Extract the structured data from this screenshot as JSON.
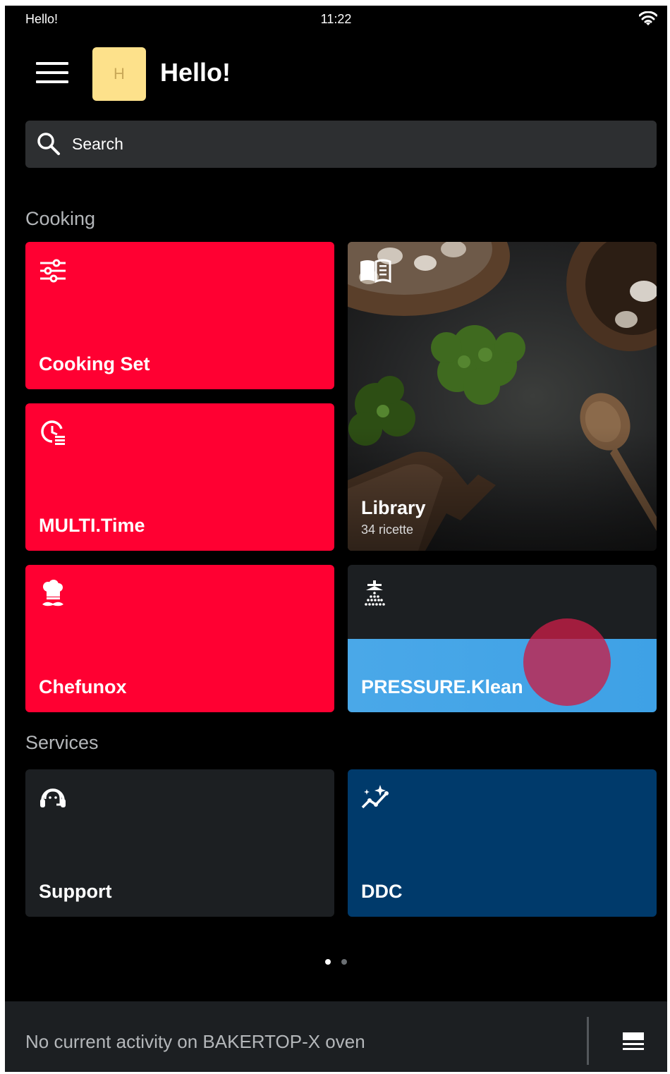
{
  "status_bar": {
    "left_text": "Hello!",
    "time": "11:22"
  },
  "header": {
    "avatar_initial": "H",
    "title": "Hello!"
  },
  "search": {
    "placeholder": "Search"
  },
  "sections": {
    "cooking": "Cooking",
    "services": "Services"
  },
  "tiles": {
    "cooking_set": "Cooking Set",
    "multi_time": "MULTI.Time",
    "chefunox": "Chefunox",
    "library": "Library",
    "library_count": "34 ricette",
    "pressure_klean": "PRESSURE.Klean",
    "support": "Support",
    "ddc": "DDC"
  },
  "bottom_bar": {
    "message": "No current activity on BAKERTOP-X oven"
  },
  "colors": {
    "accent_red": "#ff0032",
    "tile_dark": "#1c1f22",
    "ddc_navy": "#003a6b",
    "pressure_blue": "#3ea1e6",
    "avatar_yellow": "#fde18b"
  },
  "icons": {
    "cooking_set": "sliders-icon",
    "multi_time": "multi-timer-icon",
    "chefunox": "chef-hat-icon",
    "library": "recipe-book-icon",
    "pressure_klean": "shower-clean-icon",
    "support": "headset-icon",
    "ddc": "sparkle-chart-icon"
  },
  "pagination": {
    "current": 1,
    "total": 2
  }
}
